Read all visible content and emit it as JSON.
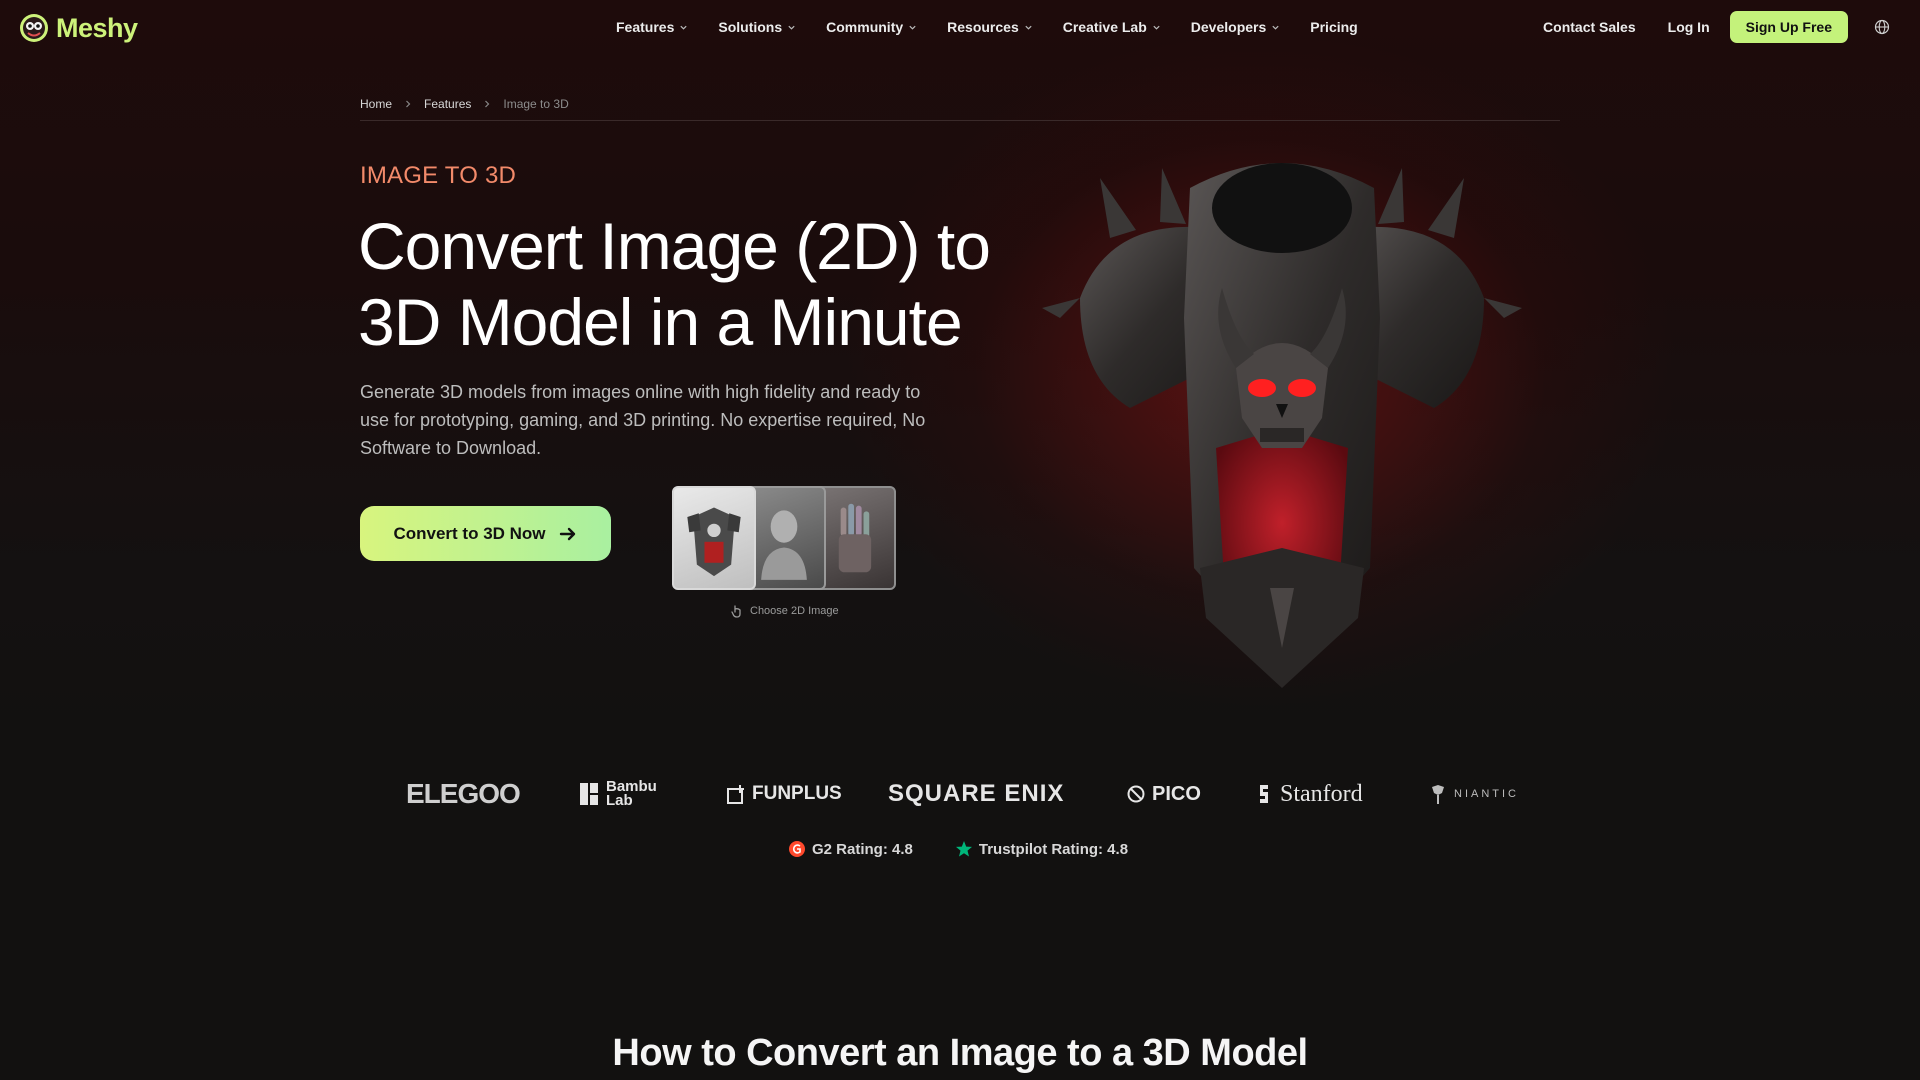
{
  "brand": {
    "name": "Meshy",
    "accent": "#c4f27b"
  },
  "nav": {
    "menu": [
      {
        "label": "Features",
        "has_dropdown": true
      },
      {
        "label": "Solutions",
        "has_dropdown": true
      },
      {
        "label": "Community",
        "has_dropdown": true
      },
      {
        "label": "Resources",
        "has_dropdown": true
      },
      {
        "label": "Creative Lab",
        "has_dropdown": true
      },
      {
        "label": "Developers",
        "has_dropdown": true
      },
      {
        "label": "Pricing",
        "has_dropdown": false
      }
    ],
    "contact_label": "Contact Sales",
    "login_label": "Log In",
    "signup_label": "Sign Up Free",
    "language_icon": "globe-icon"
  },
  "breadcrumb": [
    "Home",
    "Features",
    "Image to 3D"
  ],
  "hero": {
    "eyebrow": "IMAGE TO 3D",
    "eyebrow_color": "#f28a6a",
    "headline_line1": "Convert Image (2D) to",
    "headline_line2": "3D Model in a Minute",
    "lead": "Generate 3D models from images online with high fidelity and ready to use for prototyping, gaming, and 3D printing. No expertise required, No Software to Download.",
    "cta_label": "Convert to 3D Now",
    "thumbs_caption": "Choose 2D Image"
  },
  "logos": {
    "elegoo": "ELEGOO",
    "bambu_line1": "Bambu",
    "bambu_line2": "Lab",
    "funplus": "FUNPLUS",
    "square_enix": "SQUARE ENIX",
    "pico": "PICO",
    "stanford": "Stanford",
    "niantic": "NIANTIC"
  },
  "ratings": {
    "g2": "G2 Rating: 4.8",
    "trustpilot": "Trustpilot Rating: 4.8",
    "g2_color": "#ff492c",
    "trustpilot_color": "#00b67a"
  },
  "section": {
    "title": "How to Convert an Image to a 3D Model"
  }
}
